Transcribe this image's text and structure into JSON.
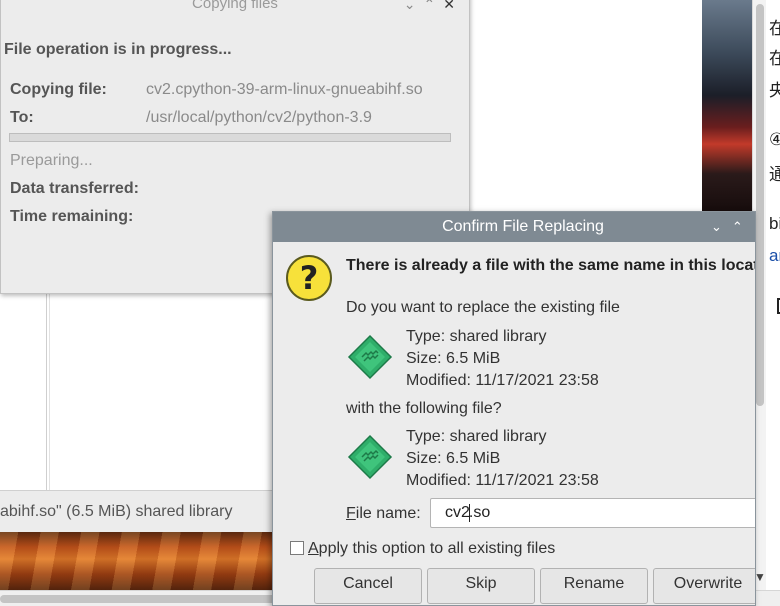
{
  "background": {
    "file_manager_status": "abihf.so\" (6.5 MiB) shared library",
    "browser_fragments": [
      "在",
      "在",
      "央",
      "④",
      "通",
      "bi",
      "ar"
    ]
  },
  "copy_dialog": {
    "title": "Copying files",
    "heading": "File operation is in progress...",
    "copying_label": "Copying file:",
    "copying_value": "cv2.cpython-39-arm-linux-gnueabihf.so",
    "to_label": "To:",
    "to_value": "/usr/local/python/cv2/python-3.9",
    "progress_fraction": 0,
    "status": "Preparing...",
    "data_label": "Data transferred:",
    "time_label": "Time remaining:"
  },
  "replace_dialog": {
    "title": "Confirm File Replacing",
    "heading": "There is already a file with the same name in this location",
    "question": "Do you want to replace the existing file",
    "existing": {
      "type": "Type: shared library",
      "size": "Size: 6.5 MiB",
      "modified": "Modified: 11/17/2021 23:58"
    },
    "with_text": "with the following file?",
    "new": {
      "type": "Type: shared library",
      "size": "Size: 6.5 MiB",
      "modified": "Modified: 11/17/2021 23:58"
    },
    "filename_label_mnemonic": "F",
    "filename_label_rest": "ile name:",
    "filename_before_cursor": "cv2",
    "filename_after_cursor": ".so",
    "apply_checked": false,
    "apply_mnemonic": "A",
    "apply_rest": "pply this option to all existing files",
    "buttons": {
      "cancel": "Cancel",
      "skip": "Skip",
      "rename": "Rename",
      "overwrite": "Overwrite"
    }
  },
  "colors": {
    "title_bar": "#7f8a93",
    "dialog_bg": "#ececec",
    "question_icon": "#f7e13a",
    "file_icon": "#2fae6a"
  },
  "icons": {
    "question": "question-icon",
    "file": "shared-library-file-icon"
  }
}
